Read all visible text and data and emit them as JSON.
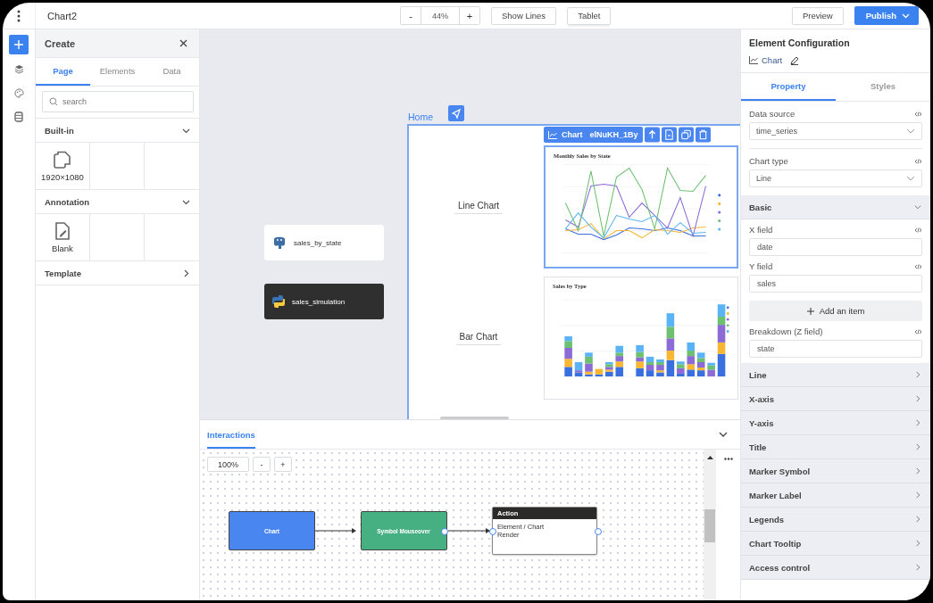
{
  "app_bar": {
    "title": "Chart2",
    "zoom_out": "-",
    "zoom": "44%",
    "zoom_in": "+",
    "show_lines": "Show Lines",
    "device": "Tablet",
    "preview": "Preview",
    "publish": "Publish"
  },
  "rail": [
    {
      "kind": "add",
      "selected": true
    },
    {
      "kind": "layers",
      "selected": false
    },
    {
      "kind": "palette",
      "selected": false
    },
    {
      "kind": "database",
      "selected": false
    }
  ],
  "create_panel": {
    "title": "Create",
    "tabs": [
      {
        "label": "Page",
        "selected": true
      },
      {
        "label": "Elements",
        "selected": false
      },
      {
        "label": "Data",
        "selected": false
      }
    ],
    "search": {
      "placeholder": "search"
    },
    "sections": [
      {
        "title": "Built-in",
        "expanded": true,
        "items": [
          {
            "kind": "pages",
            "label": "1920×1080"
          }
        ]
      },
      {
        "title": "Annotation",
        "expanded": true,
        "items": [
          {
            "kind": "document",
            "label": "Blank"
          }
        ]
      },
      {
        "title": "Template",
        "expanded": false
      }
    ]
  },
  "canvas": {
    "data_nodes": [
      {
        "kind": "database",
        "label": "sales_by_state",
        "selected": false
      },
      {
        "kind": "script",
        "label": "sales_simulation",
        "selected": true
      }
    ],
    "page": {
      "title": "Home",
      "toolbar": {
        "type": "Chart",
        "id": "elNuKH_1By"
      },
      "rows": [
        {
          "label": "Line Chart",
          "chart": {
            "kind": "line",
            "title": "Monthly Sales by State",
            "selected": true
          }
        },
        {
          "label": "Bar Chart",
          "chart": {
            "kind": "bar",
            "title": "Sales by Type",
            "selected": false
          }
        }
      ]
    }
  },
  "interactions": {
    "tab": "Interactions",
    "zoom": "100%",
    "zoom_out": "-",
    "zoom_in": "+",
    "nodes": [
      {
        "kind": "trigger",
        "label": "Chart"
      },
      {
        "kind": "event",
        "label": "Symbol Mouseover"
      },
      {
        "kind": "action",
        "label": "Action",
        "lines": [
          "Element / Chart",
          "Render"
        ]
      }
    ]
  },
  "config": {
    "title": "Element Configuration",
    "element": "Chart",
    "tabs": [
      {
        "label": "Property",
        "selected": true
      },
      {
        "label": "Styles",
        "selected": false
      }
    ],
    "fields": [
      {
        "kind": "select",
        "label": "Data source",
        "value": "time_series"
      },
      {
        "kind": "select",
        "label": "Chart type",
        "value": "Line"
      }
    ],
    "sections": [
      {
        "title": "Basic",
        "expanded": true,
        "fields": [
          {
            "kind": "input",
            "label": "X field",
            "value": "date"
          },
          {
            "kind": "input",
            "label": "Y field",
            "value": "sales"
          },
          {
            "kind": "add",
            "label": "Add an item"
          },
          {
            "kind": "input",
            "label": "Breakdown (Z field)",
            "value": "state"
          }
        ]
      },
      {
        "title": "Line",
        "expanded": false
      },
      {
        "title": "X-axis",
        "expanded": false
      },
      {
        "title": "Y-axis",
        "expanded": false
      },
      {
        "title": "Title",
        "expanded": false
      },
      {
        "title": "Marker Symbol",
        "expanded": false
      },
      {
        "title": "Marker Label",
        "expanded": false
      },
      {
        "title": "Legends",
        "expanded": false
      },
      {
        "title": "Chart Tooltip",
        "expanded": false
      },
      {
        "title": "Access control",
        "expanded": false
      }
    ]
  }
}
